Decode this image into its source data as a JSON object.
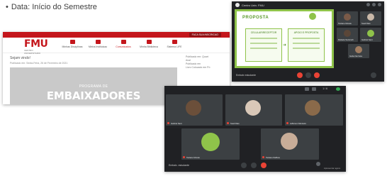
{
  "caption": {
    "bullet": "•",
    "text": "Data: Início do Semestre"
  },
  "fmu": {
    "top_button": "FACA SUA INSCRICAO",
    "logo": "FMU",
    "logo_sub": "CENTRO UNIVERSITARIO",
    "menu": [
      {
        "label": "Minhas Disciplinas"
      },
      {
        "label": "Minha Instituicao"
      },
      {
        "label": "Comunicados"
      },
      {
        "label": "Minha Biblioteca"
      },
      {
        "label": "Sistema LIFE"
      }
    ],
    "post_title": "Sejam vindo!",
    "post_date": "Publicado em: Sexta-Feira, 26 de Fevereiro de 2021",
    "side_lines": [
      "Publicado em: Quart",
      "Aval",
      "Publicado em",
      "Livro Colocado em Pó"
    ],
    "banner_small": "PROGRAMA DE",
    "banner_big": "EMBAIXADORES ESTUDANTIS"
  },
  "meet1": {
    "title": "Centro Univ. FMU",
    "slide_heading": "PROPOSTA",
    "card1": "CELULAR/RECEPTOR",
    "card2": "APOIO E PROPOSTA",
    "time": "Embaix estudante",
    "tiles": [
      {
        "name": "Taciane Morais"
      },
      {
        "name": "Sueli Dias"
      },
      {
        "name": "Rafaela Sartorelli"
      },
      {
        "name": "Gabriel Sant"
      },
      {
        "name": "Gaba Nezzeta"
      }
    ]
  },
  "meet2": {
    "count": "1 / 6",
    "time": "Embaix. estudante",
    "present_label": "Apresentar agora",
    "tiles": [
      {
        "name": "Gabriel Sant"
      },
      {
        "name": "Sueli Dias"
      },
      {
        "name": "Jefferson Monteiro"
      },
      {
        "name": "Taciane Morais"
      },
      {
        "name": "Taciane Dalfiore"
      }
    ]
  }
}
